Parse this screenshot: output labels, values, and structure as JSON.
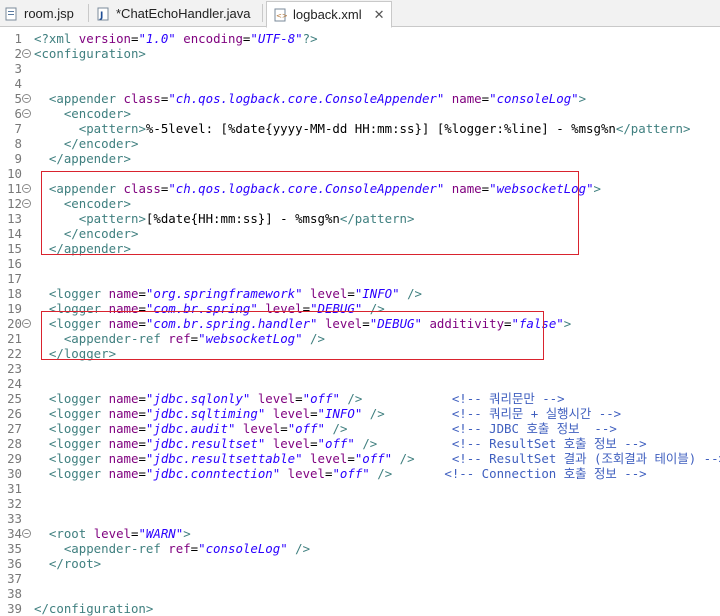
{
  "tabs": [
    {
      "label": "room.jsp",
      "icon": "jsp-file-icon"
    },
    {
      "label": "*ChatEchoHandler.java",
      "icon": "java-file-icon"
    },
    {
      "label": "logback.xml",
      "icon": "xml-file-icon",
      "active": true
    }
  ],
  "lines": [
    {
      "n": "1",
      "fold": false,
      "tokens": [
        [
          "t",
          "<?xml "
        ],
        [
          "a",
          "version"
        ],
        [
          "x",
          "="
        ],
        [
          "v",
          "\"1.0\""
        ],
        [
          "x",
          " "
        ],
        [
          "a",
          "encoding"
        ],
        [
          "x",
          "="
        ],
        [
          "v",
          "\"UTF-8\""
        ],
        [
          "t",
          "?>"
        ]
      ]
    },
    {
      "n": "2",
      "fold": true,
      "tokens": [
        [
          "t",
          "<configuration>"
        ]
      ]
    },
    {
      "n": "3",
      "fold": false,
      "tokens": []
    },
    {
      "n": "4",
      "fold": false,
      "tokens": []
    },
    {
      "n": "5",
      "fold": true,
      "tokens": [
        [
          "x",
          "  "
        ],
        [
          "t",
          "<appender "
        ],
        [
          "a",
          "class"
        ],
        [
          "x",
          "="
        ],
        [
          "v",
          "\"ch.qos.logback.core.ConsoleAppender\""
        ],
        [
          "x",
          " "
        ],
        [
          "a",
          "name"
        ],
        [
          "x",
          "="
        ],
        [
          "v",
          "\"consoleLog\""
        ],
        [
          "t",
          ">"
        ]
      ]
    },
    {
      "n": "6",
      "fold": true,
      "tokens": [
        [
          "x",
          "    "
        ],
        [
          "t",
          "<encoder>"
        ]
      ]
    },
    {
      "n": "7",
      "fold": false,
      "tokens": [
        [
          "x",
          "      "
        ],
        [
          "t",
          "<pattern>"
        ],
        [
          "x",
          "%-5level: [%date{yyyy-MM-dd HH:mm:ss}] [%logger:%line] - %msg%n"
        ],
        [
          "t",
          "</pattern>"
        ]
      ]
    },
    {
      "n": "8",
      "fold": false,
      "tokens": [
        [
          "x",
          "    "
        ],
        [
          "t",
          "</encoder>"
        ]
      ]
    },
    {
      "n": "9",
      "fold": false,
      "tokens": [
        [
          "x",
          "  "
        ],
        [
          "t",
          "</appender>"
        ]
      ]
    },
    {
      "n": "10",
      "fold": false,
      "tokens": []
    },
    {
      "n": "11",
      "fold": true,
      "tokens": [
        [
          "x",
          "  "
        ],
        [
          "t",
          "<appender "
        ],
        [
          "a",
          "class"
        ],
        [
          "x",
          "="
        ],
        [
          "v",
          "\"ch.qos.logback.core.ConsoleAppender\""
        ],
        [
          "x",
          " "
        ],
        [
          "a",
          "name"
        ],
        [
          "x",
          "="
        ],
        [
          "v",
          "\"websocketLog\""
        ],
        [
          "t",
          ">"
        ]
      ]
    },
    {
      "n": "12",
      "fold": true,
      "tokens": [
        [
          "x",
          "    "
        ],
        [
          "t",
          "<encoder>"
        ]
      ]
    },
    {
      "n": "13",
      "fold": false,
      "tokens": [
        [
          "x",
          "      "
        ],
        [
          "t",
          "<pattern>"
        ],
        [
          "x",
          "[%date{HH:mm:ss}] - %msg%n"
        ],
        [
          "t",
          "</pattern>"
        ]
      ]
    },
    {
      "n": "14",
      "fold": false,
      "tokens": [
        [
          "x",
          "    "
        ],
        [
          "t",
          "</encoder>"
        ]
      ]
    },
    {
      "n": "15",
      "fold": false,
      "tokens": [
        [
          "x",
          "  "
        ],
        [
          "t",
          "</appender>"
        ]
      ]
    },
    {
      "n": "16",
      "fold": false,
      "tokens": []
    },
    {
      "n": "17",
      "fold": false,
      "tokens": []
    },
    {
      "n": "18",
      "fold": false,
      "tokens": [
        [
          "x",
          "  "
        ],
        [
          "t",
          "<logger "
        ],
        [
          "a",
          "name"
        ],
        [
          "x",
          "="
        ],
        [
          "v",
          "\"org.springframework\""
        ],
        [
          "x",
          " "
        ],
        [
          "a",
          "level"
        ],
        [
          "x",
          "="
        ],
        [
          "v",
          "\"INFO\""
        ],
        [
          "x",
          " "
        ],
        [
          "t",
          "/>"
        ]
      ]
    },
    {
      "n": "19",
      "fold": false,
      "tokens": [
        [
          "x",
          "  "
        ],
        [
          "t",
          "<logger "
        ],
        [
          "a",
          "name"
        ],
        [
          "x",
          "="
        ],
        [
          "v",
          "\"com.br.spring\""
        ],
        [
          "x",
          " "
        ],
        [
          "a",
          "level"
        ],
        [
          "x",
          "="
        ],
        [
          "v",
          "\"DEBUG\""
        ],
        [
          "x",
          " "
        ],
        [
          "t",
          "/>"
        ]
      ]
    },
    {
      "n": "20",
      "fold": true,
      "tokens": [
        [
          "x",
          "  "
        ],
        [
          "t",
          "<logger "
        ],
        [
          "a",
          "name"
        ],
        [
          "x",
          "="
        ],
        [
          "v",
          "\"com.br.spring.handler\""
        ],
        [
          "x",
          " "
        ],
        [
          "a",
          "level"
        ],
        [
          "x",
          "="
        ],
        [
          "v",
          "\"DEBUG\""
        ],
        [
          "x",
          " "
        ],
        [
          "a",
          "additivity"
        ],
        [
          "x",
          "="
        ],
        [
          "v",
          "\"false\""
        ],
        [
          "t",
          ">"
        ]
      ]
    },
    {
      "n": "21",
      "fold": false,
      "tokens": [
        [
          "x",
          "    "
        ],
        [
          "t",
          "<appender-ref "
        ],
        [
          "a",
          "ref"
        ],
        [
          "x",
          "="
        ],
        [
          "v",
          "\"websocketLog\""
        ],
        [
          "x",
          " "
        ],
        [
          "t",
          "/>"
        ]
      ]
    },
    {
      "n": "22",
      "fold": false,
      "tokens": [
        [
          "x",
          "  "
        ],
        [
          "t",
          "</logger>"
        ]
      ]
    },
    {
      "n": "23",
      "fold": false,
      "tokens": []
    },
    {
      "n": "24",
      "fold": false,
      "tokens": []
    },
    {
      "n": "25",
      "fold": false,
      "tokens": [
        [
          "x",
          "  "
        ],
        [
          "t",
          "<logger "
        ],
        [
          "a",
          "name"
        ],
        [
          "x",
          "="
        ],
        [
          "v",
          "\"jdbc.sqlonly\""
        ],
        [
          "x",
          " "
        ],
        [
          "a",
          "level"
        ],
        [
          "x",
          "="
        ],
        [
          "v",
          "\"off\""
        ],
        [
          "x",
          " "
        ],
        [
          "t",
          "/>"
        ],
        [
          "x",
          "            "
        ],
        [
          "c",
          "<!-- 쿼리문만 -->"
        ]
      ]
    },
    {
      "n": "26",
      "fold": false,
      "tokens": [
        [
          "x",
          "  "
        ],
        [
          "t",
          "<logger "
        ],
        [
          "a",
          "name"
        ],
        [
          "x",
          "="
        ],
        [
          "v",
          "\"jdbc.sqltiming\""
        ],
        [
          "x",
          " "
        ],
        [
          "a",
          "level"
        ],
        [
          "x",
          "="
        ],
        [
          "v",
          "\"INFO\""
        ],
        [
          "x",
          " "
        ],
        [
          "t",
          "/>"
        ],
        [
          "x",
          "         "
        ],
        [
          "c",
          "<!-- 쿼리문 + 실행시간 -->"
        ]
      ]
    },
    {
      "n": "27",
      "fold": false,
      "tokens": [
        [
          "x",
          "  "
        ],
        [
          "t",
          "<logger "
        ],
        [
          "a",
          "name"
        ],
        [
          "x",
          "="
        ],
        [
          "v",
          "\"jdbc.audit\""
        ],
        [
          "x",
          " "
        ],
        [
          "a",
          "level"
        ],
        [
          "x",
          "="
        ],
        [
          "v",
          "\"off\""
        ],
        [
          "x",
          " "
        ],
        [
          "t",
          "/>"
        ],
        [
          "x",
          "              "
        ],
        [
          "c",
          "<!-- JDBC 호출 정보  -->"
        ]
      ]
    },
    {
      "n": "28",
      "fold": false,
      "tokens": [
        [
          "x",
          "  "
        ],
        [
          "t",
          "<logger "
        ],
        [
          "a",
          "name"
        ],
        [
          "x",
          "="
        ],
        [
          "v",
          "\"jdbc.resultset\""
        ],
        [
          "x",
          " "
        ],
        [
          "a",
          "level"
        ],
        [
          "x",
          "="
        ],
        [
          "v",
          "\"off\""
        ],
        [
          "x",
          " "
        ],
        [
          "t",
          "/>"
        ],
        [
          "x",
          "          "
        ],
        [
          "c",
          "<!-- ResultSet 호출 정보 -->"
        ]
      ]
    },
    {
      "n": "29",
      "fold": false,
      "tokens": [
        [
          "x",
          "  "
        ],
        [
          "t",
          "<logger "
        ],
        [
          "a",
          "name"
        ],
        [
          "x",
          "="
        ],
        [
          "v",
          "\"jdbc.resultsettable\""
        ],
        [
          "x",
          " "
        ],
        [
          "a",
          "level"
        ],
        [
          "x",
          "="
        ],
        [
          "v",
          "\"off\""
        ],
        [
          "x",
          " "
        ],
        [
          "t",
          "/>"
        ],
        [
          "x",
          "     "
        ],
        [
          "c",
          "<!-- ResultSet 결과 (조회결과 테이블) -->"
        ]
      ]
    },
    {
      "n": "30",
      "fold": false,
      "tokens": [
        [
          "x",
          "  "
        ],
        [
          "t",
          "<logger "
        ],
        [
          "a",
          "name"
        ],
        [
          "x",
          "="
        ],
        [
          "v",
          "\"jdbc.conntection\""
        ],
        [
          "x",
          " "
        ],
        [
          "a",
          "level"
        ],
        [
          "x",
          "="
        ],
        [
          "v",
          "\"off\""
        ],
        [
          "x",
          " "
        ],
        [
          "t",
          "/>"
        ],
        [
          "x",
          "       "
        ],
        [
          "c",
          "<!-- Connection 호출 정보 -->"
        ]
      ]
    },
    {
      "n": "31",
      "fold": false,
      "tokens": []
    },
    {
      "n": "32",
      "fold": false,
      "tokens": []
    },
    {
      "n": "33",
      "fold": false,
      "tokens": []
    },
    {
      "n": "34",
      "fold": true,
      "tokens": [
        [
          "x",
          "  "
        ],
        [
          "t",
          "<root "
        ],
        [
          "a",
          "level"
        ],
        [
          "x",
          "="
        ],
        [
          "v",
          "\"WARN\""
        ],
        [
          "t",
          ">"
        ]
      ]
    },
    {
      "n": "35",
      "fold": false,
      "tokens": [
        [
          "x",
          "    "
        ],
        [
          "t",
          "<appender-ref "
        ],
        [
          "a",
          "ref"
        ],
        [
          "x",
          "="
        ],
        [
          "v",
          "\"consoleLog\""
        ],
        [
          "x",
          " "
        ],
        [
          "t",
          "/>"
        ]
      ]
    },
    {
      "n": "36",
      "fold": false,
      "tokens": [
        [
          "x",
          "  "
        ],
        [
          "t",
          "</root>"
        ]
      ]
    },
    {
      "n": "37",
      "fold": false,
      "tokens": []
    },
    {
      "n": "38",
      "fold": false,
      "tokens": []
    },
    {
      "n": "39",
      "fold": false,
      "tokens": [
        [
          "t",
          "</configuration>"
        ]
      ]
    }
  ],
  "highlight_color": "#d9232e"
}
